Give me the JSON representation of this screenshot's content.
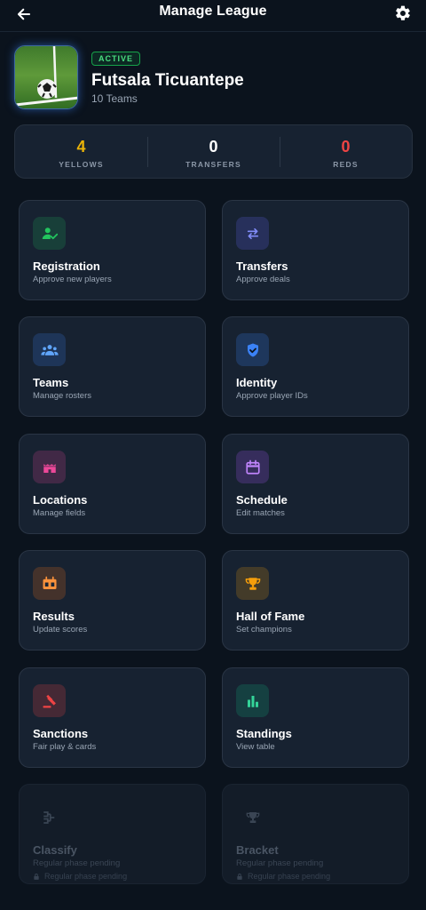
{
  "header": {
    "title": "Manage League"
  },
  "league": {
    "status": "ACTIVE",
    "name": "Futsala Ticuantepe",
    "team_count": "10 Teams"
  },
  "stats": [
    {
      "value": "4",
      "label": "YELLOWS",
      "color": "#eab308"
    },
    {
      "value": "0",
      "label": "TRANSFERS",
      "color": "#ffffff"
    },
    {
      "value": "0",
      "label": "REDS",
      "color": "#ef4444"
    }
  ],
  "cards": [
    {
      "title": "Registration",
      "subtitle": "Approve new players",
      "icon": "user-check-icon",
      "color": "#22c55e"
    },
    {
      "title": "Transfers",
      "subtitle": "Approve deals",
      "icon": "swap-arrows-icon",
      "color": "#818cf8"
    },
    {
      "title": "Teams",
      "subtitle": "Manage rosters",
      "icon": "group-icon",
      "color": "#60a5fa"
    },
    {
      "title": "Identity",
      "subtitle": "Approve player IDs",
      "icon": "shield-check-icon",
      "color": "#3b82f6"
    },
    {
      "title": "Locations",
      "subtitle": "Manage fields",
      "icon": "stadium-icon",
      "color": "#ec4899"
    },
    {
      "title": "Schedule",
      "subtitle": "Edit matches",
      "icon": "calendar-icon",
      "color": "#c084fc"
    },
    {
      "title": "Results",
      "subtitle": "Update scores",
      "icon": "scoreboard-icon",
      "color": "#fb923c"
    },
    {
      "title": "Hall of Fame",
      "subtitle": "Set champions",
      "icon": "trophy-icon",
      "color": "#f59e0b"
    },
    {
      "title": "Sanctions",
      "subtitle": "Fair play & cards",
      "icon": "gavel-icon",
      "color": "#ef4444"
    },
    {
      "title": "Standings",
      "subtitle": "View table",
      "icon": "bar-chart-icon",
      "color": "#34d399"
    },
    {
      "title": "Classify",
      "subtitle": "Regular phase pending",
      "lock_text": "Regular phase pending",
      "icon": "bracket-tree-icon",
      "color": "#3a4554"
    },
    {
      "title": "Bracket",
      "subtitle": "Regular phase pending",
      "lock_text": "Regular phase pending",
      "icon": "trophy-icon",
      "color": "#3a4554"
    }
  ]
}
